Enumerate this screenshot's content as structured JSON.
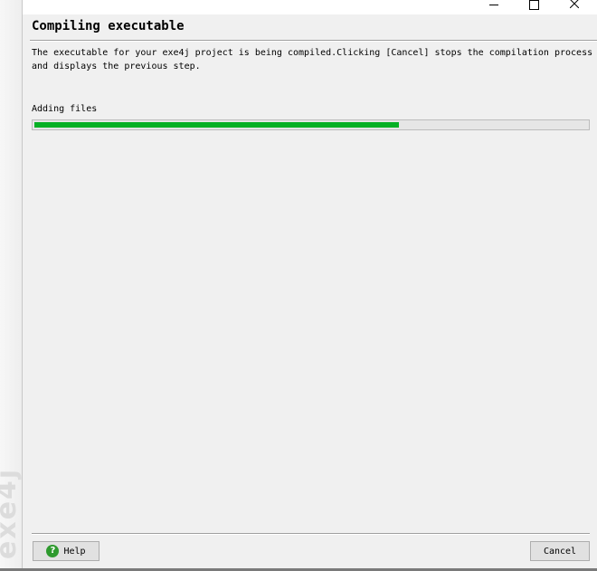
{
  "window": {
    "controls": [
      "minimize-icon",
      "maximize-icon",
      "close-icon"
    ]
  },
  "side_panel": {
    "logo_text": "exe4j"
  },
  "header": {
    "title": "Compiling executable"
  },
  "description": {
    "line1": "The executable for your exe4j project is being compiled.Clicking [Cancel] stops the compilation process",
    "line2": "and displays the previous step."
  },
  "progress": {
    "label": "Adding files",
    "fraction": 0.66,
    "color": "#06b025"
  },
  "footer": {
    "help_label": "Help",
    "help_icon": "help-question-icon",
    "cancel_label": "Cancel"
  }
}
